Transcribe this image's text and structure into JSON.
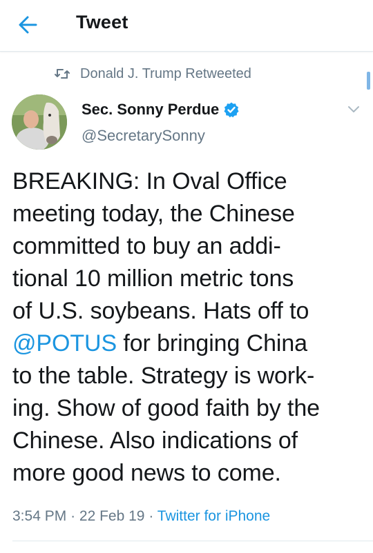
{
  "header": {
    "title": "Tweet",
    "back_icon": "arrow-left-icon"
  },
  "colors": {
    "accent": "#1b95e0",
    "text": "#14171a",
    "secondary_text": "#657786",
    "divider": "#e1e8ed"
  },
  "retweet_context": {
    "icon": "retweet-icon",
    "text": "Donald J. Trump Retweeted"
  },
  "tweet": {
    "author": {
      "display_name": "Sec. Sonny Perdue",
      "verified": true,
      "handle": "@SecretarySonny"
    },
    "text_lines": [
      [
        "BREAKING: In Oval Office"
      ],
      [
        "meeting today, the Chinese"
      ],
      [
        "committed to buy an addi-"
      ],
      [
        "tional 10 million metric tons"
      ],
      [
        "of U.S. soybeans. Hats off to"
      ],
      [
        "@POTUS",
        " for bringing China"
      ],
      [
        "to the table. Strategy is work-"
      ],
      [
        "ing. Show of good faith by the"
      ],
      [
        "Chinese. Also indications of"
      ],
      [
        "more good news to come."
      ]
    ],
    "time": "3:54 PM",
    "separator": "·",
    "date": "22 Feb 19",
    "source": "Twitter for iPhone"
  }
}
